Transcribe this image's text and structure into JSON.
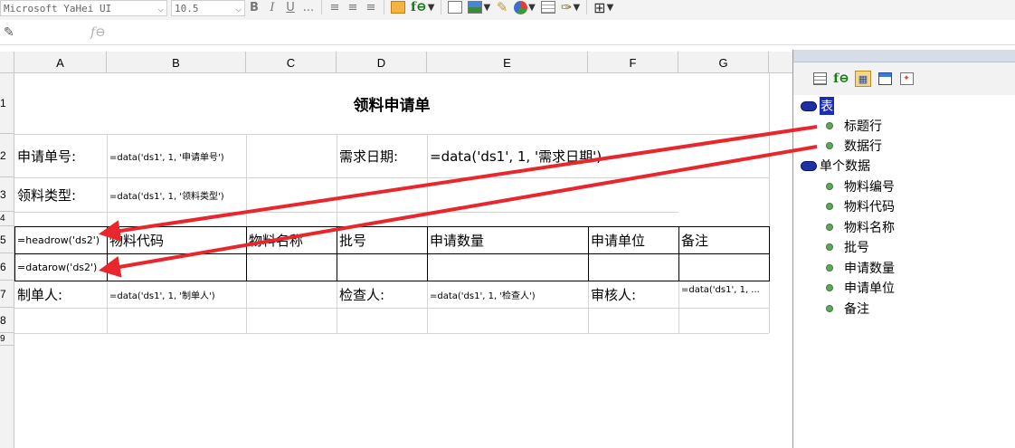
{
  "toolbar": {
    "font_name": "Microsoft YaHei UI",
    "font_size": "10.5",
    "bold": "B",
    "italic": "I",
    "underline": "U",
    "more": "...",
    "fx": "f⊖"
  },
  "formula_bar": {
    "fx": "f⊖",
    "value": ""
  },
  "columns": [
    "A",
    "B",
    "C",
    "D",
    "E",
    "F",
    "G"
  ],
  "rows": [
    "1",
    "2",
    "3",
    "4",
    "5",
    "6",
    "7",
    "8",
    "9"
  ],
  "sheet": {
    "title": "领料申请单",
    "r2": {
      "a": "申请单号:",
      "b": "=data('ds1', 1, '申请单号')",
      "d": "需求日期:",
      "e": "=data('ds1', 1, '需求日期')"
    },
    "r3": {
      "a": "领料类型:",
      "b": "=data('ds1', 1, '领料类型')"
    },
    "r5": {
      "a": "=headrow('ds2')",
      "b": "物料代码",
      "c": "物料名称",
      "d": "批号",
      "e": "申请数量",
      "f": "申请单位",
      "g": "备注"
    },
    "r6": {
      "a": "=datarow('ds2')"
    },
    "r7": {
      "a": "制单人:",
      "b": "=data('ds1', 1, '制单人')",
      "d": "检查人:",
      "e": "=data('ds1', 1, '检查人')",
      "f": "审核人:",
      "g": "=data('ds1', 1, ..."
    }
  },
  "tree": {
    "root": "表",
    "root_children": [
      "标题行",
      "数据行"
    ],
    "single": "单个数据",
    "fields": [
      "物料编号",
      "物料代码",
      "物料名称",
      "批号",
      "申请数量",
      "申请单位",
      "备注"
    ]
  },
  "colors": {
    "arrow": "#e8262b",
    "tree_pill": "#1f2fa6",
    "tree_dot": "#62a65e"
  }
}
